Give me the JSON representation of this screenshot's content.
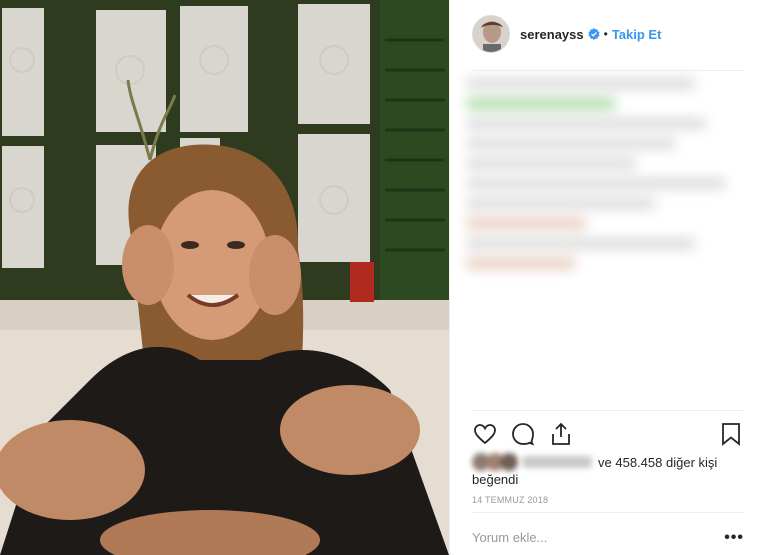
{
  "post": {
    "username": "serenayss",
    "verified": true,
    "separator": "•",
    "follow_label": "Takip Et",
    "photo_subject": "smiling woman with curly hair resting face on hands"
  },
  "actions": {
    "like_icon": "heart-icon",
    "comment_icon": "comment-icon",
    "share_icon": "share-icon",
    "save_icon": "bookmark-icon"
  },
  "likes": {
    "prefix": "ve",
    "count": "458.458",
    "suffix": "diğer kişi",
    "line2": "beğendi"
  },
  "date": "14 TEMMUZ 2018",
  "comment": {
    "placeholder": "Yorum ekle...",
    "more_label": "•••"
  },
  "colors": {
    "accent": "#3897f0",
    "text": "#262626",
    "muted": "#999999"
  }
}
